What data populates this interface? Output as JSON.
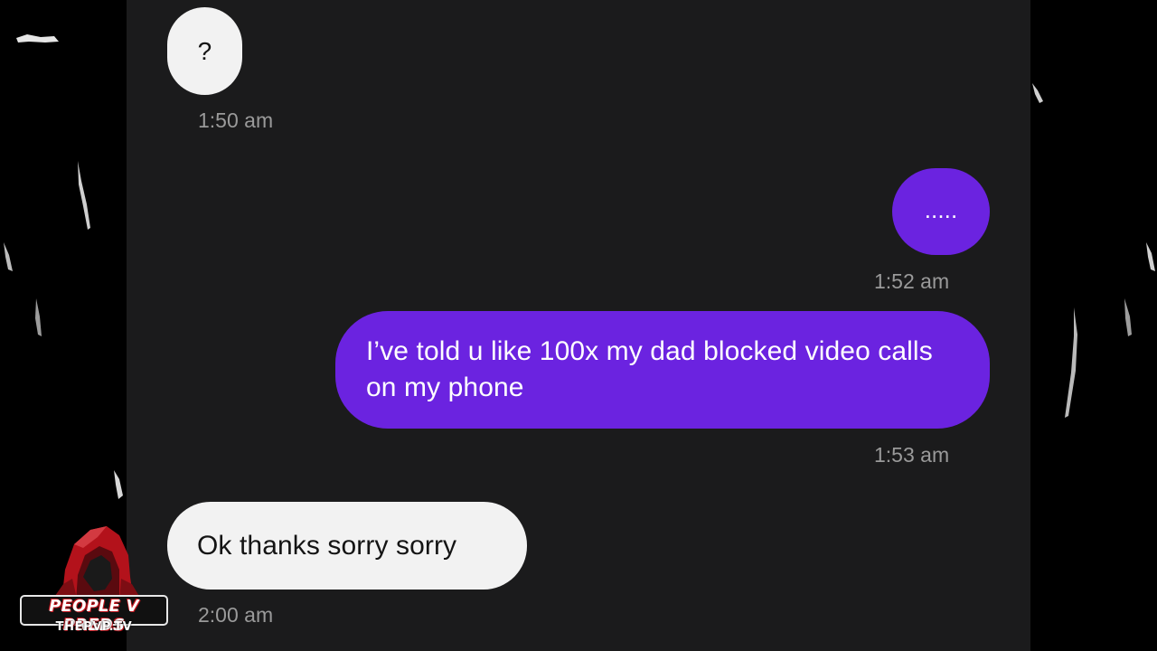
{
  "theme": {
    "chat_background": "#1b1b1c",
    "incoming_bubble": "#f2f2f2",
    "outgoing_bubble": "#6b23e0",
    "timestamp_color": "#9a9a9a"
  },
  "messages": [
    {
      "direction": "incoming",
      "text": "?",
      "time": "1:50 am"
    },
    {
      "direction": "outgoing",
      "text": ".....",
      "time": "1:52 am"
    },
    {
      "direction": "outgoing",
      "text": "I’ve told u like 100x my dad blocked video calls on my phone",
      "time": "1:53 am"
    },
    {
      "direction": "incoming",
      "text": "Ok thanks sorry sorry",
      "time": "2:00 am"
    }
  ],
  "watermark": {
    "name": "PEOPLE V PREDS",
    "site": "THEPVP.TV",
    "icon": "hooded-figure-icon",
    "accent": "#c0131b"
  }
}
